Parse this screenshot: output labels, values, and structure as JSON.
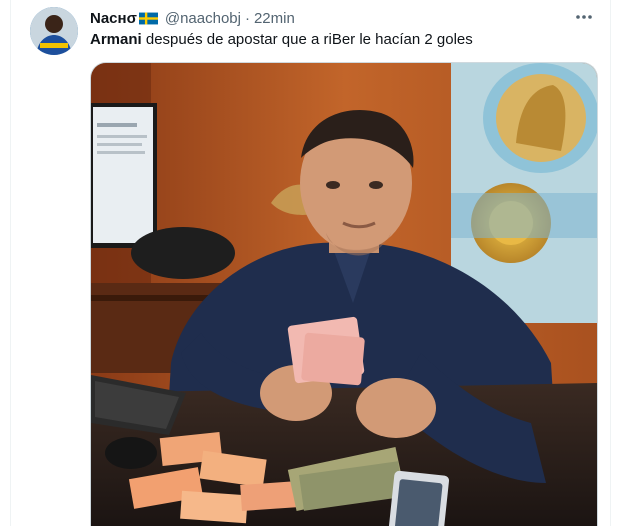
{
  "tweet": {
    "display_name": "Nacнσ",
    "flag_icon": "sweden-flag-icon",
    "handle": "@naachobj",
    "separator": "·",
    "time": "22min",
    "text_bold": "Armani",
    "text_rest": " después de apostar que a riBer le hacían 2 goles",
    "more_icon": "more-options-icon"
  },
  "colors": {
    "text_primary": "#0f1419",
    "text_secondary": "#536471",
    "border": "#cfd9de"
  }
}
